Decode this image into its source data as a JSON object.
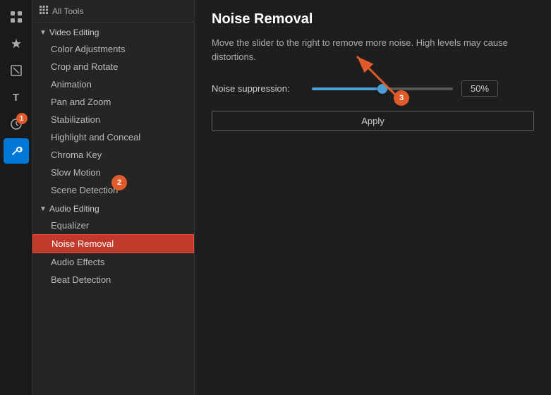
{
  "iconBar": {
    "icons": [
      {
        "name": "grid-add-icon",
        "symbol": "⊞",
        "active": false,
        "badge": null
      },
      {
        "name": "star-icon",
        "symbol": "✦",
        "active": false,
        "badge": null
      },
      {
        "name": "crop-icon",
        "symbol": "⬜",
        "active": false,
        "badge": null
      },
      {
        "name": "text-icon",
        "symbol": "T",
        "active": false,
        "badge": null
      },
      {
        "name": "clock-icon",
        "symbol": "◷",
        "active": false,
        "badge": "1"
      },
      {
        "name": "tools-icon",
        "symbol": "🔧",
        "active": true,
        "badge": null
      }
    ]
  },
  "sidebar": {
    "allToolsLabel": "All Tools",
    "sections": [
      {
        "label": "Video Editing",
        "expanded": true,
        "items": [
          {
            "label": "Color Adjustments",
            "active": false
          },
          {
            "label": "Crop and Rotate",
            "active": false
          },
          {
            "label": "Animation",
            "active": false
          },
          {
            "label": "Pan and Zoom",
            "active": false
          },
          {
            "label": "Stabilization",
            "active": false
          },
          {
            "label": "Highlight and Conceal",
            "active": false
          },
          {
            "label": "Chroma Key",
            "active": false
          },
          {
            "label": "Slow Motion",
            "active": false
          },
          {
            "label": "Scene Detection",
            "active": false
          }
        ]
      },
      {
        "label": "Audio Editing",
        "expanded": true,
        "items": [
          {
            "label": "Equalizer",
            "active": false
          },
          {
            "label": "Noise Removal",
            "active": true
          },
          {
            "label": "Audio Effects",
            "active": false
          },
          {
            "label": "Beat Detection",
            "active": false
          }
        ]
      }
    ]
  },
  "main": {
    "title": "Noise Removal",
    "description": "Move the slider to the right to remove more noise. High levels may cause distortions.",
    "controls": {
      "suppressionLabel": "Noise suppression:",
      "suppressionValue": "50%",
      "sliderPercent": 50
    },
    "applyLabel": "Apply"
  },
  "annotations": {
    "badge1": "1",
    "badge2": "2",
    "badge3": "3"
  }
}
